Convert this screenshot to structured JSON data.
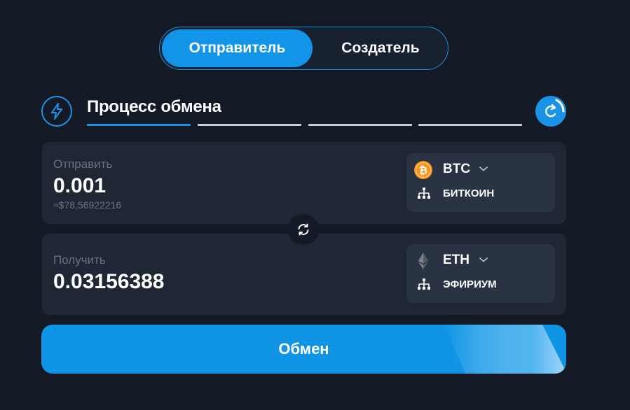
{
  "mode_toggle": {
    "sender_label": "Отправитель",
    "creator_label": "Создатель",
    "active": "sender"
  },
  "header": {
    "icon": "lightning-icon",
    "title": "Процесс обмена",
    "steps_total": 4,
    "steps_active": 1,
    "refresh_icon": "refresh-icon"
  },
  "send": {
    "label": "Отправить",
    "amount": "0.001",
    "fiat_estimate": "≈$78,56922216",
    "coin": {
      "ticker": "BTC",
      "network": "БИТКОИН",
      "icon": "bitcoin-icon",
      "color": "#f7931a"
    }
  },
  "swap": {
    "icon": "swap-icon"
  },
  "receive": {
    "label": "Получить",
    "amount": "0.03156388",
    "coin": {
      "ticker": "ETH",
      "network": "ЭФИРИУМ",
      "icon": "ethereum-icon",
      "color": "#8a8f99"
    }
  },
  "exchange_button": {
    "label": "Обмен"
  },
  "colors": {
    "accent": "#1295e8",
    "background": "#131a26",
    "panel": "#1f2735",
    "selector": "#2a3344",
    "muted_text": "#6b7382"
  }
}
